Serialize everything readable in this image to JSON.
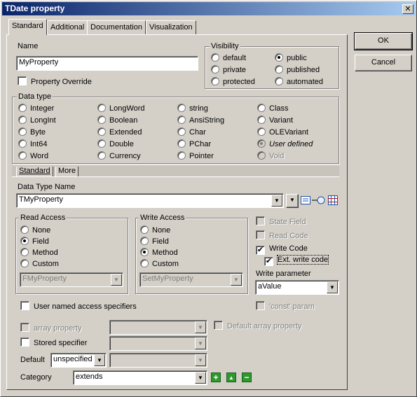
{
  "window": {
    "title": "TDate property",
    "close_glyph": "✕"
  },
  "tabs": [
    "Standard",
    "Additional",
    "Documentation",
    "Visualization"
  ],
  "buttons": {
    "ok": "OK",
    "cancel": "Cancel"
  },
  "name": {
    "label": "Name",
    "value": "MyProperty"
  },
  "property_override": {
    "label": "Property Override",
    "checked": false
  },
  "visibility": {
    "title": "Visibility",
    "options": [
      "default",
      "private",
      "protected",
      "public",
      "published",
      "automated"
    ],
    "selected": "public"
  },
  "data_type": {
    "title": "Data type",
    "options": [
      "Integer",
      "LongInt",
      "Byte",
      "Int64",
      "Word",
      "LongWord",
      "Boolean",
      "Extended",
      "Double",
      "Currency",
      "string",
      "AnsiString",
      "Char",
      "PChar",
      "Pointer",
      "Class",
      "Variant",
      "OLEVariant",
      "User defined",
      "Void"
    ],
    "selected": "User defined",
    "disabled": [
      "Void"
    ]
  },
  "subtabs": [
    "Standard",
    "More"
  ],
  "data_type_name": {
    "label": "Data Type Name",
    "value": "TMyProperty"
  },
  "icons": {
    "list": "list-icon",
    "connect": "connector-icon",
    "class": "class-grid-icon"
  },
  "read_access": {
    "title": "Read Access",
    "options": [
      "None",
      "Field",
      "Method",
      "Custom"
    ],
    "selected": "Field",
    "combo_value": "FMyProperty"
  },
  "write_access": {
    "title": "Write Access",
    "options": [
      "None",
      "Field",
      "Method",
      "Custom"
    ],
    "selected": "Method",
    "combo_value": "SetMyProperty"
  },
  "right_checks": {
    "state_field": {
      "label": "State Field",
      "checked": false,
      "enabled": false
    },
    "read_code": {
      "label": "Read Code",
      "checked": false,
      "enabled": false
    },
    "write_code": {
      "label": "Write Code",
      "checked": true,
      "enabled": true
    },
    "ext_write_code": {
      "label": "Ext. write code",
      "checked": true,
      "enabled": true
    }
  },
  "write_parameter": {
    "label": "Write parameter",
    "value": "aValue"
  },
  "user_named": {
    "label": "User named access specifiers",
    "checked": false
  },
  "const_param": {
    "label": "'const' param",
    "checked": false,
    "enabled": false
  },
  "array_property": {
    "label": "array property",
    "checked": false,
    "enabled": false
  },
  "default_array": {
    "label": "Default array property",
    "checked": false,
    "enabled": false
  },
  "stored_specifier": {
    "label": "Stored specifier",
    "checked": false
  },
  "default_field": {
    "label": "Default",
    "value": "unspecified"
  },
  "category": {
    "label": "Category",
    "value": "extends"
  },
  "check_glyph": "✔",
  "dropdown_glyph": "▼",
  "category_buttons": {
    "add": "+",
    "up": "▲",
    "remove": "−"
  }
}
